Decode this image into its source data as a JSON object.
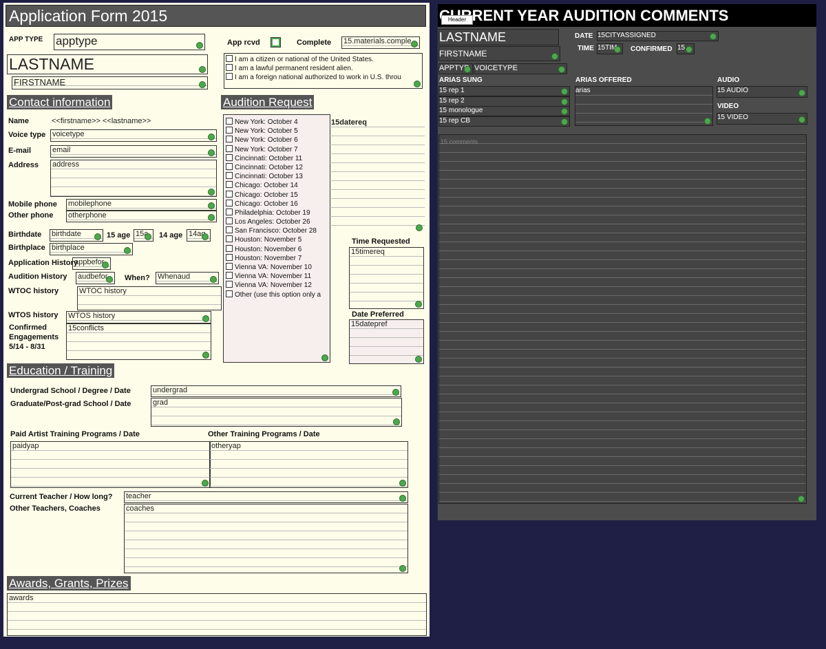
{
  "colors": {
    "background": "#1f1f45",
    "form_bg": "#fdfde9",
    "section_bg": "#555555",
    "panel_bg": "#4c4c4c",
    "marker": "#4da84d"
  },
  "left": {
    "title": "Application Form 2015",
    "app_type_label": "APP TYPE",
    "apptype_value": "apptype",
    "app_rcvd_label": "App rcvd",
    "complete_label": "Complete",
    "complete_value": "15.materials.comple",
    "lastname": "LASTNAME",
    "firstname": "FIRSTNAME",
    "citizenship": [
      "I am a citizen or national of the United States.",
      "I am a lawful permanent resident alien.",
      "I am a foreign national authorized to work in U.S. throu"
    ],
    "contact_header": "Contact information",
    "name_label": "Name",
    "name_value": "<<firstname>> <<lastname>>",
    "voice_label": "Voice type",
    "voice_value": "voicetype",
    "email_label": "E-mail",
    "email_value": "email",
    "address_label": "Address",
    "address_value": "address",
    "mobile_label": "Mobile phone",
    "mobile_value": "mobilephone",
    "other_label": "Other phone",
    "other_value": "otherphone",
    "birthdate_label": "Birthdate",
    "birthdate_value": "birthdate",
    "age15_label": "15 age",
    "age15_value": "15a",
    "age14_label": "14 age",
    "age14_value": "14ag",
    "birthplace_label": "Birthplace",
    "birthplace_value": "birthplace",
    "apphist_label": "Application History",
    "apphist_value": "appbefor",
    "audhist_label": "Audition History",
    "audhist_value": "audbefor",
    "when_label": "When?",
    "when_value": "Whenaud",
    "wtoc_label": "WTOC history",
    "wtoc_value": "WTOC history",
    "wtos_label": "WTOS history",
    "wtos_value": "WTOS history",
    "confirmed_label_1": "Confirmed",
    "confirmed_label_2": "Engagements",
    "confirmed_label_3": "5/14 - 8/31",
    "conflicts_value": "15conflicts",
    "audition_header": "Audition Request",
    "audition_options": [
      "New York: October 4",
      "New York: October 5",
      "New York: October 6",
      "New York: October 7",
      "Cincinnati: October 11",
      "Cincinnati: October 12",
      "Cincinnati: October 13",
      "Chicago: October 14",
      "Chicago: October 15",
      "Chicago: October 16",
      "Philadelphia: October 19",
      "Los Angeles: October 26",
      "San Francisco: October 28",
      "Houston: November 5",
      "Houston: November 6",
      "Houston: November 7",
      "Vienna VA: November 10",
      "Vienna VA: November 11",
      "Vienna VA: November 12",
      "Other (use this option only a"
    ],
    "datereq_value": "15datereq",
    "time_requested_label": "Time Requested",
    "timereq_value": "15timereq",
    "date_preferred_label": "Date Preferred",
    "datepref_value": "15datepref",
    "education_header": "Education / Training",
    "undergrad_label": "Undergrad School / Degree / Date",
    "undergrad_value": "undergrad",
    "grad_label": "Graduate/Post-grad School / Date",
    "grad_value": "grad",
    "paid_label": "Paid Artist Training Programs  /  Date",
    "paid_value": "paidyap",
    "othertrain_label": "Other Training Programs   /   Date",
    "othertrain_value": "otheryap",
    "teacher_label": "Current Teacher / How long?",
    "teacher_value": "teacher",
    "coaches_label": "Other Teachers, Coaches",
    "coaches_value": "coaches",
    "awards_header": "Awards, Grants, Prizes",
    "awards_value": "awards"
  },
  "right": {
    "title": "CURRENT YEAR AUDITION COMMENTS",
    "header_tab": "Header",
    "lastname": "LASTNAME",
    "firstname": "FIRSTNAME",
    "apptype": "APPTYP",
    "voicetype": "VOICETYPE",
    "date_label": "DATE",
    "date_value": "15CITYASSIGNED",
    "time_label": "TIME",
    "time_value": "15TIM",
    "confirmed_label": "CONFIRMED",
    "confirmed_value": "15",
    "arias_sung_label": "ARIAS SUNG",
    "arias_sung": [
      "15 rep 1",
      "15 rep 2",
      "15 monologue",
      "15 rep CB"
    ],
    "arias_offered_label": "ARIAS OFFERED",
    "arias_offered_value": "arias",
    "audio_label": "AUDIO",
    "audio_value": "15 AUDIO",
    "video_label": "VIDEO",
    "video_value": "15 VIDEO",
    "comments_value": "15 comments"
  }
}
